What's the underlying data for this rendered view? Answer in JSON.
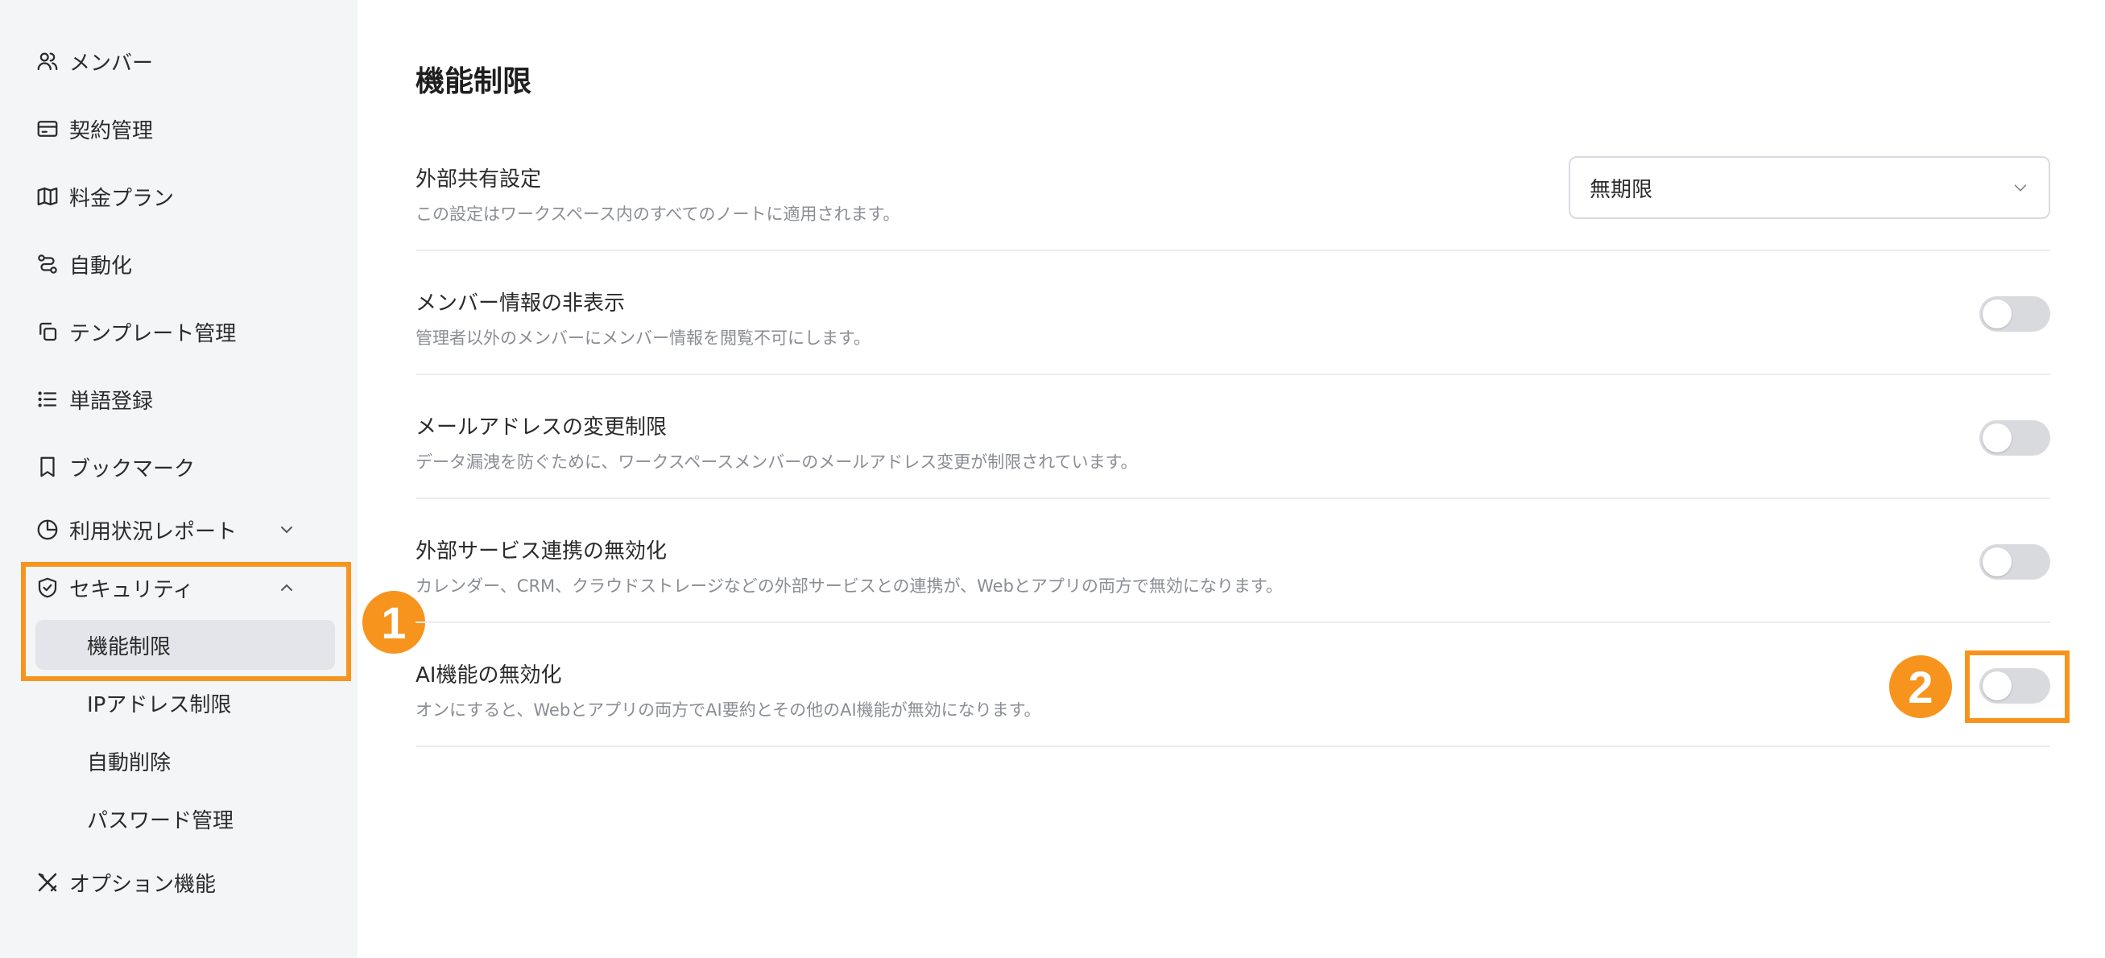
{
  "sidebar": {
    "items": [
      {
        "label": "メンバー",
        "icon": "users-icon"
      },
      {
        "label": "契約管理",
        "icon": "credit-card-icon"
      },
      {
        "label": "料金プラン",
        "icon": "map-icon"
      },
      {
        "label": "自動化",
        "icon": "workflow-icon"
      },
      {
        "label": "テンプレート管理",
        "icon": "copy-icon"
      },
      {
        "label": "単語登録",
        "icon": "list-icon"
      },
      {
        "label": "ブックマーク",
        "icon": "bookmark-icon"
      },
      {
        "label": "利用状況レポート",
        "icon": "pie-chart-icon"
      },
      {
        "label": "セキュリティ",
        "icon": "shield-check-icon"
      },
      {
        "label": "オプション機能",
        "icon": "tools-icon"
      }
    ],
    "security_sub_items": [
      {
        "label": "機能制限",
        "active": true
      },
      {
        "label": "IPアドレス制限",
        "active": false
      },
      {
        "label": "自動削除",
        "active": false
      },
      {
        "label": "パスワード管理",
        "active": false
      }
    ]
  },
  "annotations": {
    "badge_1": "1",
    "badge_2": "2",
    "highlight_color": "#f7941d"
  },
  "main": {
    "title": "機能制限",
    "settings": [
      {
        "label": "外部共有設定",
        "description": "この設定はワークスペース内のすべてのノートに適用されます。",
        "control": "select",
        "value": "無期限"
      },
      {
        "label": "メンバー情報の非表示",
        "description": "管理者以外のメンバーにメンバー情報を閲覧不可にします。",
        "control": "toggle",
        "on": false
      },
      {
        "label": "メールアドレスの変更制限",
        "description": "データ漏洩を防ぐために、ワークスペースメンバーのメールアドレス変更が制限されています。",
        "control": "toggle",
        "on": false
      },
      {
        "label": "外部サービス連携の無効化",
        "description": "カレンダー、CRM、クラウドストレージなどの外部サービスとの連携が、Webとアプリの両方で無効になります。",
        "control": "toggle",
        "on": false
      },
      {
        "label": "AI機能の無効化",
        "description": "オンにすると、Webとアプリの両方でAI要約とその他のAI機能が無効になります。",
        "control": "toggle",
        "on": false
      }
    ]
  }
}
